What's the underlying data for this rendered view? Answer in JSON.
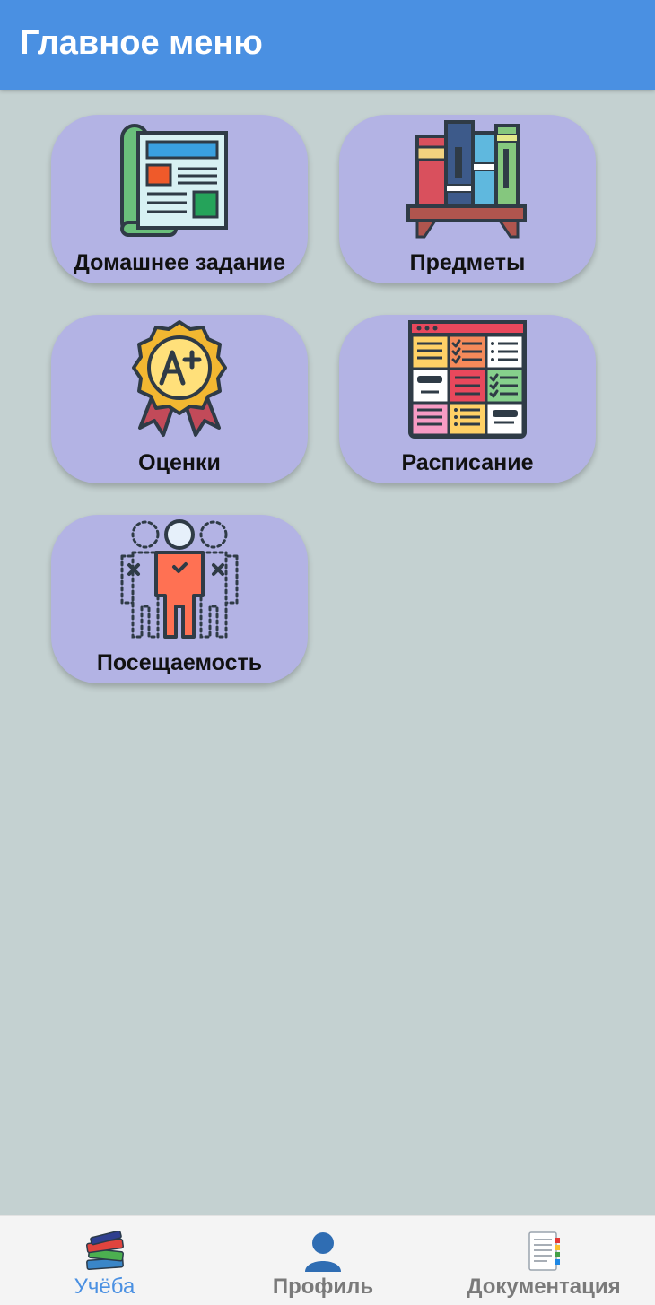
{
  "header": {
    "title": "Главное меню"
  },
  "menu": {
    "homework": {
      "label": "Домашнее задание",
      "icon": "newspaper-icon"
    },
    "subjects": {
      "label": "Предметы",
      "icon": "books-shelf-icon"
    },
    "grades": {
      "label": "Оценки",
      "icon": "award-badge-icon"
    },
    "schedule": {
      "label": "Расписание",
      "icon": "schedule-grid-icon"
    },
    "attendance": {
      "label": "Посещаемость",
      "icon": "people-attendance-icon"
    }
  },
  "bottom_nav": {
    "items": [
      {
        "label": "Учёба",
        "icon": "books-icon",
        "active": true
      },
      {
        "label": "Профиль",
        "icon": "person-icon",
        "active": false
      },
      {
        "label": "Документация",
        "icon": "document-icon",
        "active": false
      }
    ]
  },
  "colors": {
    "app_bar": "#4a90e2",
    "background": "#c4d1d1",
    "tile": "#b3b3e4",
    "active_tab": "#4a90e2",
    "inactive_tab": "#7a7a7a"
  }
}
